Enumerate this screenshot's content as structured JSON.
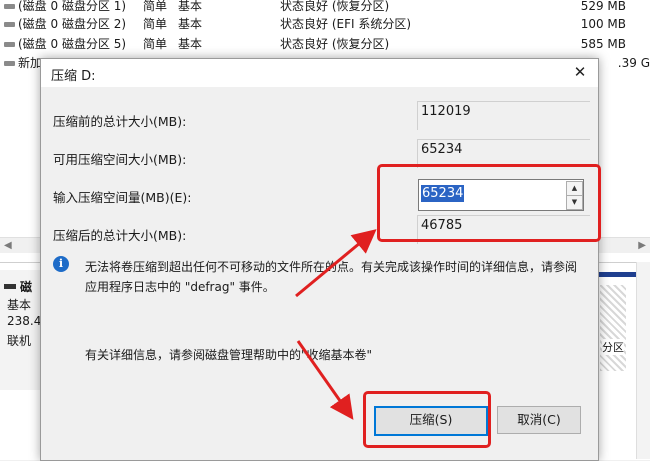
{
  "volume_list": [
    {
      "name": "(磁盘 0 磁盘分区 1)",
      "layout": "简单",
      "type": "基本",
      "status": "状态良好 (恢复分区)",
      "size": "529 MB"
    },
    {
      "name": "(磁盘 0 磁盘分区 2)",
      "layout": "简单",
      "type": "基本",
      "status": "状态良好 (EFI 系统分区)",
      "size": "100 MB"
    },
    {
      "name": "(磁盘 0 磁盘分区 5)",
      "layout": "简单",
      "type": "基本",
      "status": "状态良好 (恢复分区)",
      "size": "585 MB"
    },
    {
      "name": "新加",
      "size": ".39 G"
    }
  ],
  "disk_panel": {
    "title": "磁",
    "type": "基本",
    "size": "238.4",
    "state": "联机"
  },
  "partition_label": "分区",
  "dialog": {
    "title": "压缩 D:",
    "close_glyph": "✕",
    "total_before_label": "压缩前的总计大小(MB):",
    "total_before_value": "112019",
    "available_label": "可用压缩空间大小(MB):",
    "available_value": "65234",
    "enter_amount_label": "输入压缩空间量(MB)(E):",
    "enter_amount_value": "65234",
    "total_after_label": "压缩后的总计大小(MB):",
    "total_after_value": "46785",
    "info_icon": "i",
    "info_text": "无法将卷压缩到超出任何不可移动的文件所在的点。有关完成该操作时间的详细信息，请参阅应用程序日志中的 \"defrag\" 事件。",
    "help_text": "有关详细信息，请参阅磁盘管理帮助中的\"收缩基本卷\"",
    "shrink_button": "压缩(S)",
    "cancel_button": "取消(C)"
  },
  "colors": {
    "annotation": "#e02020",
    "selection": "#2b64c4",
    "default_button_border": "#0078d7"
  },
  "icons": [
    "drive-icon",
    "close-icon",
    "info-icon",
    "spin-up-icon",
    "spin-down-icon",
    "arrow-annotation"
  ]
}
